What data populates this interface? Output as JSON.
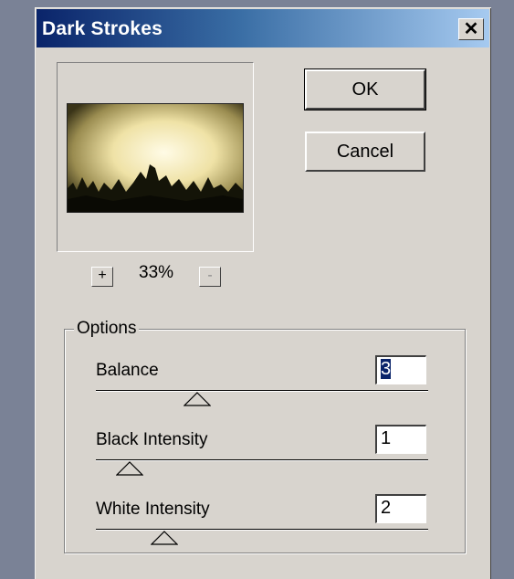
{
  "dialog": {
    "title": "Dark Strokes",
    "close_icon": "close-icon"
  },
  "preview": {
    "zoom_in_label": "+",
    "zoom_out_label": "-",
    "zoom_level": "33%"
  },
  "buttons": {
    "ok_label": "OK",
    "cancel_label": "Cancel"
  },
  "options": {
    "legend": "Options",
    "items": [
      {
        "label": "Balance",
        "value": "3"
      },
      {
        "label": "Black Intensity",
        "value": "1"
      },
      {
        "label": "White Intensity",
        "value": "2"
      }
    ]
  },
  "colors": {
    "titlebar_start": "#0a246a",
    "titlebar_end": "#a6caf0",
    "dialog_bg": "#d8d4ce",
    "selection": "#0a246a"
  }
}
